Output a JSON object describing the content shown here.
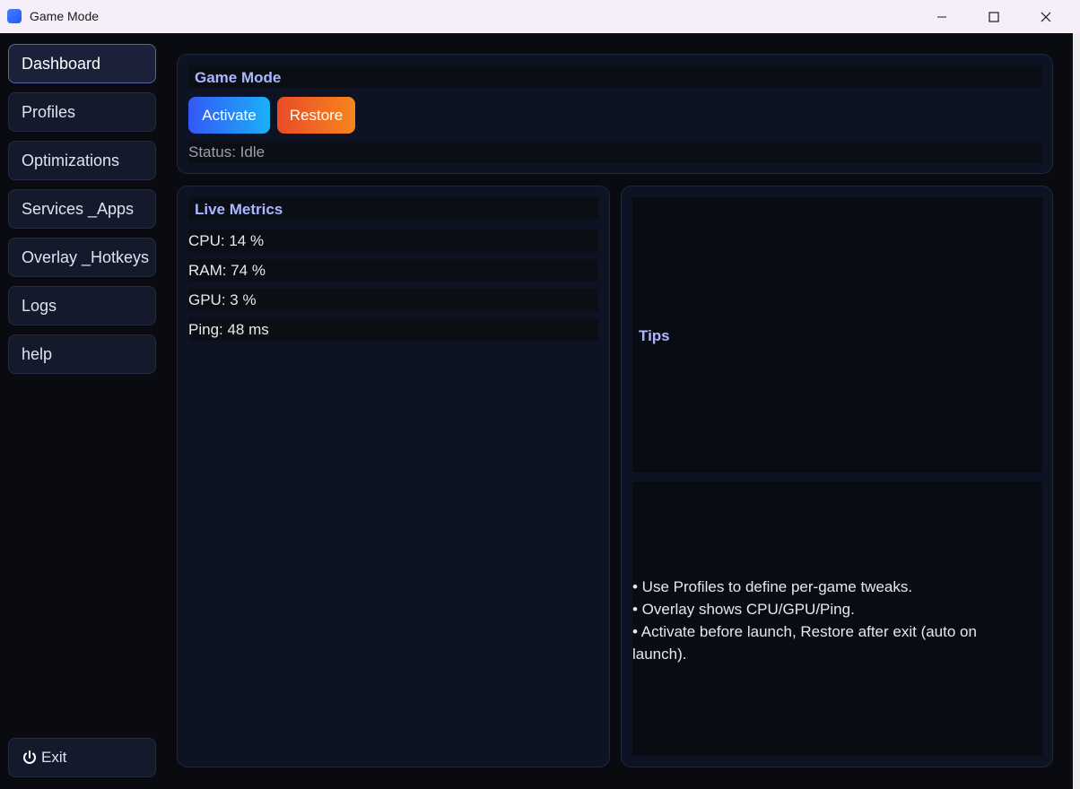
{
  "window": {
    "title": "Game Mode"
  },
  "sidebar": {
    "items": [
      {
        "label": "Dashboard",
        "active": true
      },
      {
        "label": "Profiles"
      },
      {
        "label": "Optimizations"
      },
      {
        "label": "Services _Apps"
      },
      {
        "label": "Overlay _Hotkeys"
      },
      {
        "label": "Logs"
      },
      {
        "label": "help"
      }
    ],
    "exit_label": "Exit"
  },
  "game_mode": {
    "heading": "Game Mode",
    "activate_label": "Activate",
    "restore_label": "Restore",
    "status": "Status: Idle"
  },
  "metrics": {
    "heading": "Live Metrics",
    "rows": [
      "CPU: 14 %",
      "RAM: 74 %",
      "GPU: 3 %",
      "Ping: 48 ms"
    ]
  },
  "tips": {
    "heading": "Tips",
    "lines": [
      "• Use Profiles to define per-game tweaks.",
      "• Overlay shows CPU/GPU/Ping.",
      "• Activate before launch, Restore after exit (auto on launch)."
    ]
  },
  "colors": {
    "accent_heading": "#aab7ff",
    "activate_start": "#3358f5",
    "activate_end": "#1ab0f8",
    "restore_start": "#ea4b28",
    "restore_end": "#f7851d",
    "background": "#0a0b10",
    "card": "#0d1322"
  },
  "icons": {
    "app": "app-icon",
    "minimize": "minimize-icon",
    "maximize": "maximize-icon",
    "close": "close-icon",
    "exit": "power-icon"
  }
}
